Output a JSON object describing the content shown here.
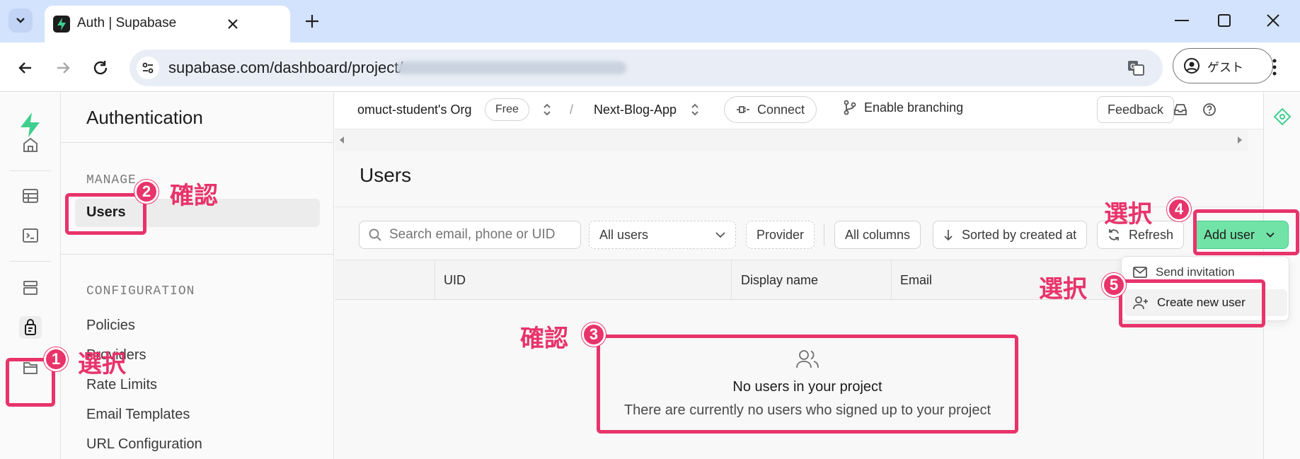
{
  "browser": {
    "tab_title": "Auth | Supabase",
    "url": "supabase.com/dashboard/project/",
    "profile_label": "ゲスト"
  },
  "topbar": {
    "org": "omuct-student's Org",
    "plan_badge": "Free",
    "separator": "/",
    "project": "Next-Blog-App",
    "connect_label": "Connect",
    "branching_label": "Enable branching",
    "feedback_label": "Feedback"
  },
  "sidebar": {
    "title": "Authentication",
    "manage_heading": "MANAGE",
    "manage_items": [
      "Users"
    ],
    "configuration_heading": "CONFIGURATION",
    "configuration_items": [
      "Policies",
      "Providers",
      "Rate Limits",
      "Email Templates",
      "URL Configuration"
    ]
  },
  "main": {
    "page_title": "Users",
    "search_placeholder": "Search email, phone or UID",
    "filter_value": "All users",
    "provider_label": "Provider",
    "columns_label": "All columns",
    "sort_label": "Sorted by created at",
    "refresh_label": "Refresh",
    "add_user_label": "Add user",
    "table_headers": [
      "UID",
      "Display name",
      "Email"
    ],
    "empty_title": "No users in your project",
    "empty_subtitle": "There are currently no users who signed up to your project"
  },
  "dropdown": {
    "items": [
      "Send invitation",
      "Create new user"
    ]
  },
  "annotations": {
    "a1": {
      "num": "1",
      "text": "選択"
    },
    "a2": {
      "num": "2",
      "text": "確認"
    },
    "a3": {
      "num": "3",
      "text": "確認"
    },
    "a4": {
      "num": "4",
      "text": "選択"
    },
    "a5": {
      "num": "5",
      "text": "選択"
    }
  },
  "colors": {
    "accent": "#e8336b",
    "brand_green": "#3ecf8e",
    "add_user_bg": "#72e3a6"
  }
}
